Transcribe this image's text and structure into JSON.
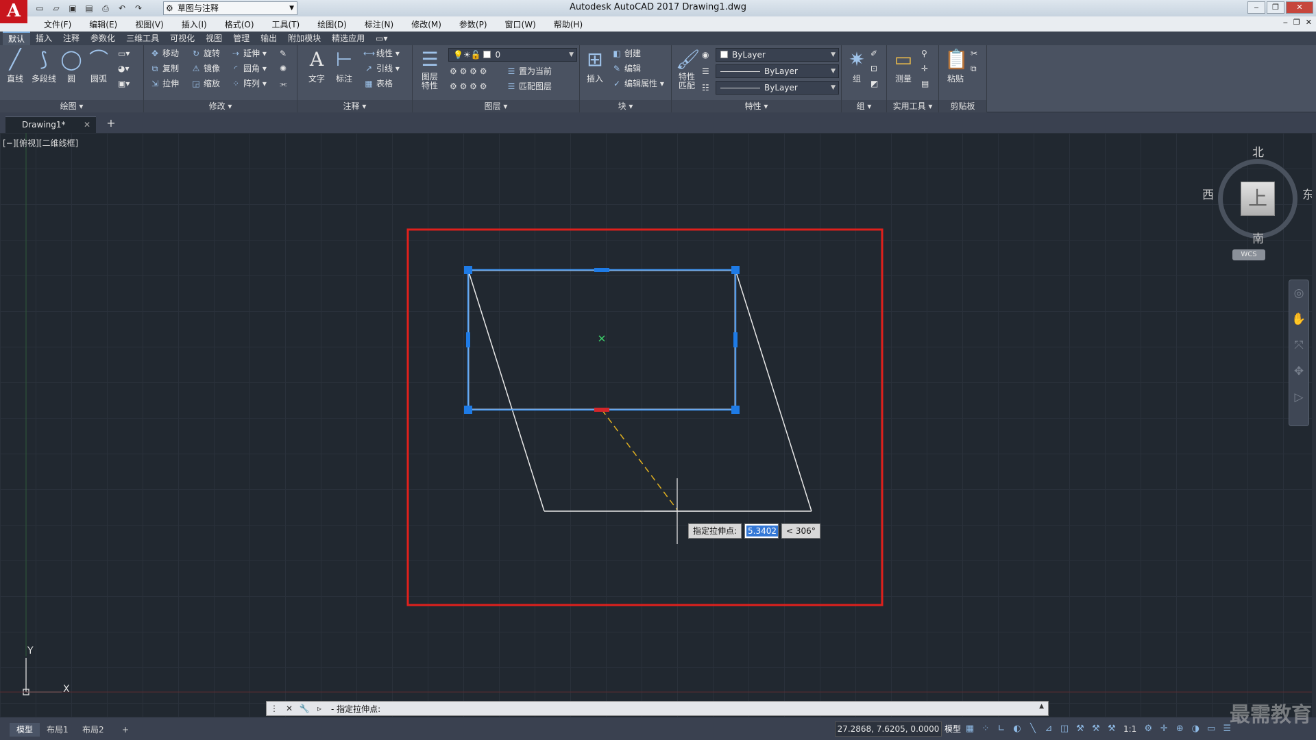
{
  "app": {
    "logo": "A",
    "title": "Autodesk AutoCAD 2017    Drawing1.dwg",
    "workspace": "草图与注释"
  },
  "quick_access": [
    "new-icon",
    "open-icon",
    "save-icon",
    "save-as-icon",
    "print-icon",
    "undo-icon",
    "redo-icon"
  ],
  "menu": [
    "文件(F)",
    "编辑(E)",
    "视图(V)",
    "插入(I)",
    "格式(O)",
    "工具(T)",
    "绘图(D)",
    "标注(N)",
    "修改(M)",
    "参数(P)",
    "窗口(W)",
    "帮助(H)"
  ],
  "ribbon_tabs": [
    "默认",
    "插入",
    "注释",
    "参数化",
    "三维工具",
    "可视化",
    "视图",
    "管理",
    "输出",
    "附加模块",
    "精选应用"
  ],
  "ribbon": {
    "draw": {
      "title": "绘图 ▾",
      "line": "直线",
      "polyline": "多段线",
      "circle": "圆",
      "arc": "圆弧"
    },
    "modify": {
      "title": "修改 ▾",
      "move": "移动",
      "rotate": "旋转",
      "trim": "延伸",
      "copy": "复制",
      "mirror": "镜像",
      "fillet": "圆角",
      "stretch": "拉伸",
      "scale": "缩放",
      "array": "阵列"
    },
    "annotation": {
      "title": "注释 ▾",
      "text": "文字",
      "dimension": "标注",
      "linear": "线性",
      "leader": "引线",
      "table": "表格"
    },
    "layers": {
      "title": "图层 ▾",
      "properties": "图层\n特性",
      "current_layer": "0",
      "set_current": "置为当前",
      "match_layer": "匹配图层"
    },
    "block": {
      "title": "块 ▾",
      "insert": "插入",
      "create": "创建",
      "edit": "编辑",
      "edit_attr": "编辑属性"
    },
    "properties": {
      "title": "特性 ▾",
      "match": "特性\n匹配",
      "color": "ByLayer",
      "linetype": "ByLayer",
      "lineweight": "ByLayer"
    },
    "groups": {
      "title": "组 ▾",
      "group": "组"
    },
    "utilities": {
      "title": "实用工具 ▾",
      "measure": "测量"
    },
    "clipboard": {
      "title": "剪贴板",
      "paste": "粘贴"
    }
  },
  "file_tab": {
    "name": "Drawing1*",
    "close": "✕",
    "new": "+"
  },
  "viewport_label": "[−][俯视][二维线框]",
  "dynamic_input": {
    "prompt": "指定拉伸点:",
    "value": "5.3402",
    "angle": "< 306°"
  },
  "viewcube": {
    "north": "北",
    "south": "南",
    "east": "东",
    "west": "西",
    "face": "上",
    "wcs": "WCS"
  },
  "ucs": {
    "x": "X",
    "y": "Y"
  },
  "command_line": {
    "text": "- 指定拉伸点:"
  },
  "status": {
    "layouts": [
      "模型",
      "布局1",
      "布局2"
    ],
    "coords": "27.2868, 7.6205, 0.0000",
    "model": "模型",
    "scale": "1:1"
  },
  "watermark": "最需教育",
  "colors": {
    "highlight_frame": "#e0201c",
    "selection": "#3e8ee6",
    "grip": "#1e7be6",
    "geometry": "#e8e8e8",
    "rubberband": "#e0b020"
  }
}
